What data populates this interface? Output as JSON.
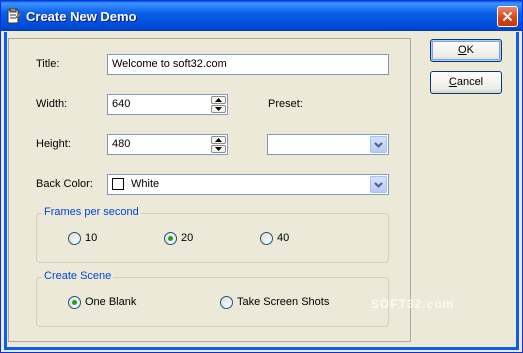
{
  "window": {
    "title": "Create New Demo"
  },
  "form": {
    "title_label": "Title:",
    "title_value": "Welcome to soft32.com",
    "width_label": "Width:",
    "width_value": "640",
    "height_label": "Height:",
    "height_value": "480",
    "preset_label": "Preset:",
    "preset_value": "",
    "backcolor_label": "Back Color:",
    "backcolor_value": "White",
    "backcolor_swatch": "#FFFFFF"
  },
  "fps_group": {
    "label": "Frames per second",
    "options": [
      "10",
      "20",
      "40"
    ],
    "selected": "20"
  },
  "scene_group": {
    "label": "Create Scene",
    "options": [
      "One Blank",
      "Take Screen Shots"
    ],
    "selected": "One Blank"
  },
  "buttons": {
    "ok_underline": "O",
    "ok_rest": "K",
    "cancel_underline": "C",
    "cancel_rest": "ancel"
  },
  "watermark": "SOFT32.com",
  "colors": {
    "titlebar": "#0A5FE8",
    "background": "#ECE9D8",
    "group_label": "#0046D5",
    "radio_dot": "#21A121"
  }
}
